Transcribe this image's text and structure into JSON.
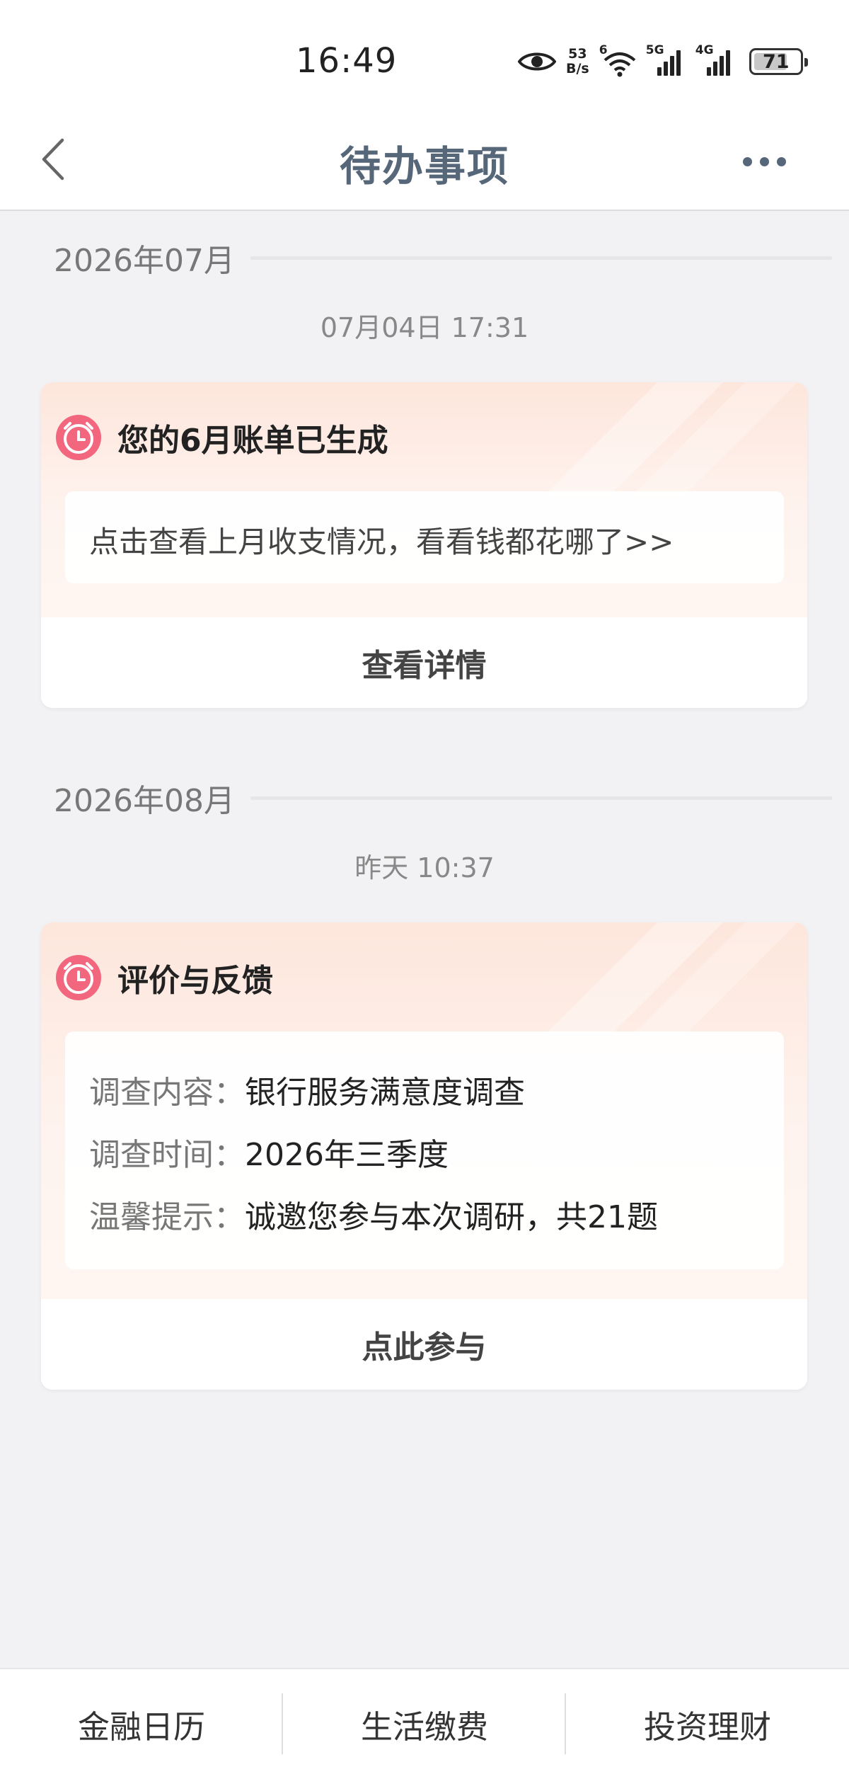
{
  "status_bar": {
    "time": "16:49",
    "net_speed_value": "53",
    "net_speed_unit": "B/s",
    "wifi_tag": "6",
    "sim1_tag": "5G",
    "sim2_tag": "4G",
    "battery": "71"
  },
  "header": {
    "title": "待办事项"
  },
  "sections": [
    {
      "month": "2026年07月",
      "time": "07月04日 17:31",
      "card": {
        "title": "您的6月账单已生成",
        "body": "点击查看上月收支情况，看看钱都花哪了>>",
        "button": "查看详情"
      }
    },
    {
      "month": "2026年08月",
      "time": "昨天 10:37",
      "card": {
        "title": "评价与反馈",
        "rows": [
          {
            "label": "调查内容：",
            "value": "银行服务满意度调查"
          },
          {
            "label": "调查时间：",
            "value": "2026年三季度"
          },
          {
            "label": "温馨提示：",
            "value": "诚邀您参与本次调研，共21题"
          }
        ],
        "button": "点此参与"
      }
    }
  ],
  "tabbar": {
    "tabs": [
      "金融日历",
      "生活缴费",
      "投资理财"
    ]
  },
  "colors": {
    "accent_title": "#56677a",
    "icon_pink": "#f0607a",
    "card_gradient": "#fde6dc"
  }
}
